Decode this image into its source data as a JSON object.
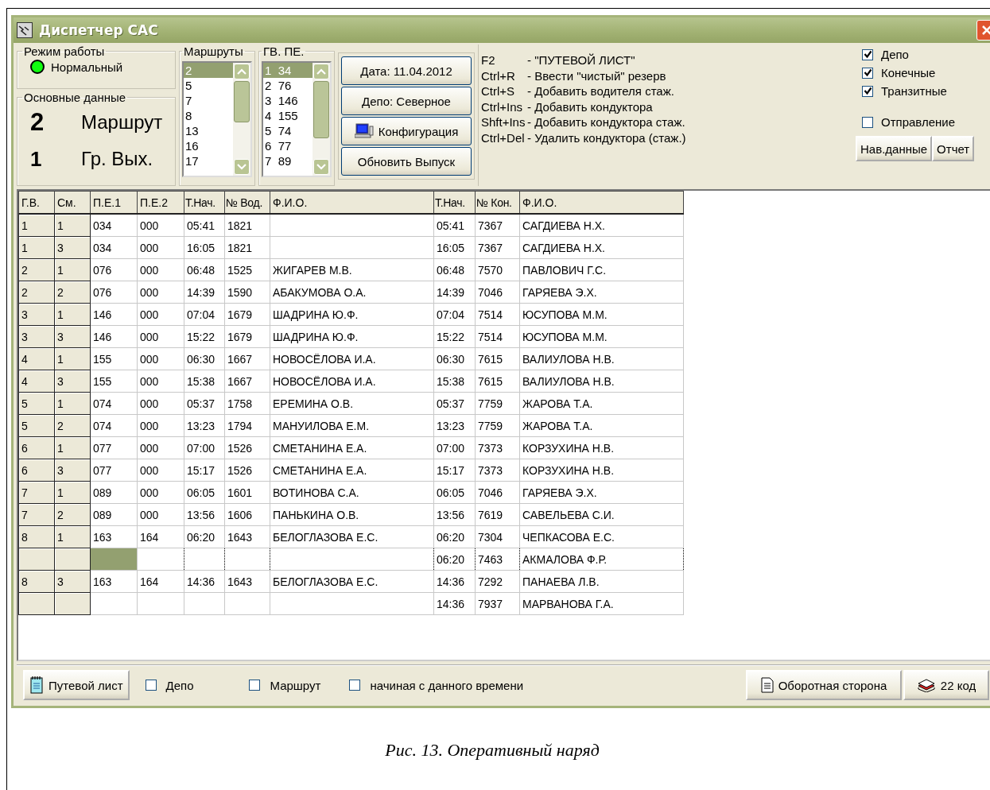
{
  "window": {
    "title": "Диспетчер САС"
  },
  "mode": {
    "legend": "Режим работы",
    "status": "Нормальный",
    "lamp_on": true
  },
  "main_data": {
    "legend": "Основные данные",
    "route_value": "2",
    "route_label": "Маршрут",
    "exit_value": "1",
    "exit_label": "Гр. Вых."
  },
  "routes": {
    "legend": "Маршруты",
    "items": [
      {
        "label": "2",
        "selected": true
      },
      {
        "label": "5",
        "selected": false
      },
      {
        "label": "7",
        "selected": false
      },
      {
        "label": "8",
        "selected": false
      },
      {
        "label": "13",
        "selected": false
      },
      {
        "label": "16",
        "selected": false
      },
      {
        "label": "17",
        "selected": false
      }
    ]
  },
  "exits": {
    "legend": "ГВ.  ПЕ.",
    "items": [
      {
        "gv": "1",
        "pe": "34",
        "selected": true
      },
      {
        "gv": "2",
        "pe": "76",
        "selected": false
      },
      {
        "gv": "3",
        "pe": "146",
        "selected": false
      },
      {
        "gv": "4",
        "pe": "155",
        "selected": false
      },
      {
        "gv": "5",
        "pe": "74",
        "selected": false
      },
      {
        "gv": "6",
        "pe": "77",
        "selected": false
      },
      {
        "gv": "7",
        "pe": "89",
        "selected": false
      }
    ]
  },
  "actions": [
    {
      "label": "Дата: 11.04.2012",
      "kind": "plain"
    },
    {
      "label": "Депо: Северное",
      "kind": "plain"
    },
    {
      "label": "Конфигурация",
      "kind": "config"
    },
    {
      "label": "Обновить Выпуск",
      "kind": "plain"
    }
  ],
  "hotkeys": [
    {
      "key": "F2",
      "desc": "- \"ПУТЕВОЙ ЛИСТ\""
    },
    {
      "key": "Ctrl+R",
      "desc": "- Ввести \"чистый\" резерв"
    },
    {
      "key": "Ctrl+S",
      "desc": "- Добавить водителя стаж."
    },
    {
      "key": "Ctrl+Ins",
      "desc": "- Добавить кондуктора"
    },
    {
      "key": "Shft+Ins",
      "desc": "- Добавить кондуктора стаж."
    },
    {
      "key": "Ctrl+Del",
      "desc": "- Удалить кондуктора (стаж.)"
    }
  ],
  "filters": [
    {
      "label": "Депо",
      "checked": true
    },
    {
      "label": "Конечные",
      "checked": true
    },
    {
      "label": "Транзитные",
      "checked": true
    }
  ],
  "departure": {
    "label": "Отправление",
    "checked": false
  },
  "side_buttons": [
    "Нав.данные",
    "Отчет"
  ],
  "table": {
    "columns": [
      "Г.В.",
      "См.",
      "П.Е.1",
      "П.Е.2",
      "Т.Нач.",
      "№ Вод.",
      "Ф.И.О.",
      "Т.Нач.",
      "№ Кон.",
      "Ф.И.О."
    ],
    "rows": [
      {
        "selected": false,
        "cells": [
          "1",
          "1",
          "034",
          "000",
          "05:41",
          "1821",
          null,
          "05:41",
          "7367",
          "САГДИЕВА Н.Х."
        ]
      },
      {
        "selected": false,
        "cells": [
          "1",
          "3",
          "034",
          "000",
          "16:05",
          "1821",
          null,
          "16:05",
          "7367",
          "САГДИЕВА Н.Х."
        ]
      },
      {
        "selected": false,
        "cells": [
          "2",
          "1",
          "076",
          "000",
          "06:48",
          "1525",
          "ЖИГАРЕВ М.В.",
          "06:48",
          "7570",
          "ПАВЛОВИЧ Г.С."
        ]
      },
      {
        "selected": false,
        "cells": [
          "2",
          "2",
          "076",
          "000",
          "14:39",
          "1590",
          "АБАКУМОВА О.А.",
          "14:39",
          "7046",
          "ГАРЯЕВА Э.Х."
        ]
      },
      {
        "selected": false,
        "cells": [
          "3",
          "1",
          "146",
          "000",
          "07:04",
          "1679",
          "ШАДРИНА Ю.Ф.",
          "07:04",
          "7514",
          "ЮСУПОВА М.М."
        ]
      },
      {
        "selected": false,
        "cells": [
          "3",
          "3",
          "146",
          "000",
          "15:22",
          "1679",
          "ШАДРИНА Ю.Ф.",
          "15:22",
          "7514",
          "ЮСУПОВА М.М."
        ]
      },
      {
        "selected": false,
        "cells": [
          "4",
          "1",
          "155",
          "000",
          "06:30",
          "1667",
          "НОВОСЁЛОВА И.А.",
          "06:30",
          "7615",
          "ВАЛИУЛОВА Н.В."
        ]
      },
      {
        "selected": false,
        "cells": [
          "4",
          "3",
          "155",
          "000",
          "15:38",
          "1667",
          "НОВОСЁЛОВА И.А.",
          "15:38",
          "7615",
          "ВАЛИУЛОВА Н.В."
        ]
      },
      {
        "selected": false,
        "cells": [
          "5",
          "1",
          "074",
          "000",
          "05:37",
          "1758",
          "ЕРЕМИНА О.В.",
          "05:37",
          "7759",
          "ЖАРОВА Т.А."
        ]
      },
      {
        "selected": false,
        "cells": [
          "5",
          "2",
          "074",
          "000",
          "13:23",
          "1794",
          "МАНУИЛОВА Е.М.",
          "13:23",
          "7759",
          "ЖАРОВА Т.А."
        ]
      },
      {
        "selected": false,
        "cells": [
          "6",
          "1",
          "077",
          "000",
          "07:00",
          "1526",
          "СМЕТАНИНА Е.А.",
          "07:00",
          "7373",
          "КОРЗУХИНА Н.В."
        ]
      },
      {
        "selected": false,
        "cells": [
          "6",
          "3",
          "077",
          "000",
          "15:17",
          "1526",
          "СМЕТАНИНА Е.А.",
          "15:17",
          "7373",
          "КОРЗУХИНА Н.В."
        ]
      },
      {
        "selected": false,
        "cells": [
          "7",
          "1",
          "089",
          "000",
          "06:05",
          "1601",
          "ВОТИНОВА С.А.",
          "06:05",
          "7046",
          "ГАРЯЕВА Э.Х."
        ]
      },
      {
        "selected": false,
        "cells": [
          "7",
          "2",
          "089",
          "000",
          "13:56",
          "1606",
          "ПАНЬКИНА О.В.",
          "13:56",
          "7619",
          "САВЕЛЬЕВА С.И."
        ]
      },
      {
        "selected": false,
        "cells": [
          "8",
          "1",
          "163",
          "164",
          "06:20",
          "1643",
          "БЕЛОГЛАЗОВА Е.С.",
          "06:20",
          "7304",
          "ЧЕПКАСОВА Е.С."
        ]
      },
      {
        "selected": true,
        "cells": [
          null,
          null,
          null,
          null,
          null,
          null,
          null,
          "06:20",
          "7463",
          "АКМАЛОВА Ф.Р."
        ]
      },
      {
        "selected": false,
        "cells": [
          "8",
          "3",
          "163",
          "164",
          "14:36",
          "1643",
          "БЕЛОГЛАЗОВА Е.С.",
          "14:36",
          "7292",
          "ПАНАЕВА Л.В."
        ]
      },
      {
        "selected": false,
        "cells": [
          null,
          null,
          null,
          null,
          null,
          null,
          null,
          "14:36",
          "7937",
          "МАРВАНОВА Г.А."
        ]
      }
    ]
  },
  "bottom": {
    "print_button": "Путевой лист",
    "options": [
      {
        "label": "Депо",
        "checked": false
      },
      {
        "label": "Маршрут",
        "checked": false
      },
      {
        "label": "начиная с данного времени",
        "checked": false
      }
    ],
    "reverse_button": "Оборотная сторона",
    "code_button": "22 код"
  },
  "caption": "Рис. 13. Оперативный наряд"
}
